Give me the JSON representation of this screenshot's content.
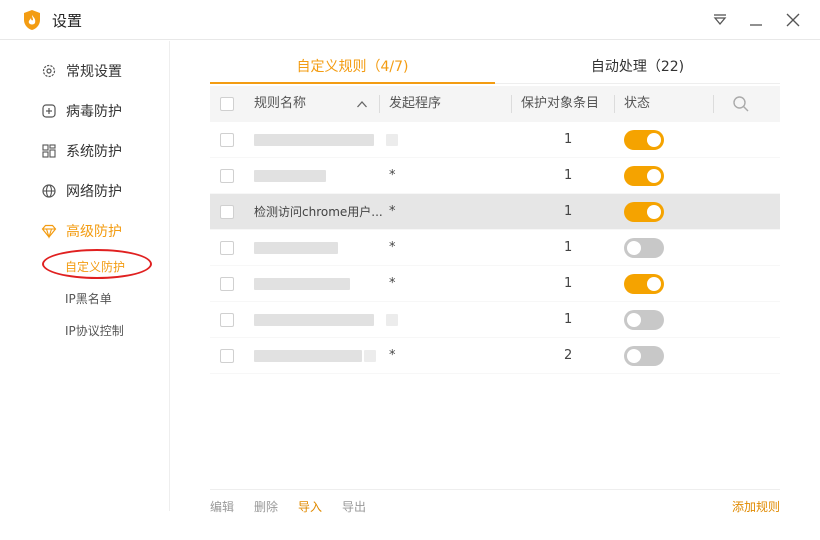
{
  "window": {
    "title": "设置"
  },
  "sidebar": {
    "items": [
      {
        "label": "常规设置",
        "icon": "gear-icon"
      },
      {
        "label": "病毒防护",
        "icon": "plus-box-icon"
      },
      {
        "label": "系统防护",
        "icon": "grid-icon"
      },
      {
        "label": "网络防护",
        "icon": "globe-icon"
      },
      {
        "label": "高级防护",
        "icon": "diamond-icon"
      }
    ],
    "sub_items": [
      {
        "label": "自定义防护"
      },
      {
        "label": "IP黑名单"
      },
      {
        "label": "IP协议控制"
      }
    ]
  },
  "tabs": [
    {
      "label": "自定义规则（4/7)"
    },
    {
      "label": "自动处理（22)"
    }
  ],
  "table": {
    "columns": [
      "规则名称",
      "发起程序",
      "保护对象条目",
      "状态"
    ],
    "rows": [
      {
        "name": "",
        "program": "",
        "count": "1",
        "enabled": true
      },
      {
        "name": "",
        "program": "*",
        "count": "1",
        "enabled": true
      },
      {
        "name": "检测访问chrome用户...",
        "program": "*",
        "count": "1",
        "enabled": true
      },
      {
        "name": "",
        "program": "*",
        "count": "1",
        "enabled": false
      },
      {
        "name": "",
        "program": "*",
        "count": "1",
        "enabled": true
      },
      {
        "name": "",
        "program": "",
        "count": "1",
        "enabled": false
      },
      {
        "name": "",
        "program": "*",
        "count": "2",
        "enabled": false
      }
    ]
  },
  "footer": {
    "edit": "编辑",
    "delete": "删除",
    "import": "导入",
    "export": "导出",
    "add_rule": "添加规则"
  },
  "colors": {
    "accent": "#f39c12",
    "toggle_on": "#f5a300",
    "toggle_off": "#c8c8c8",
    "annotation": "#e02020"
  }
}
